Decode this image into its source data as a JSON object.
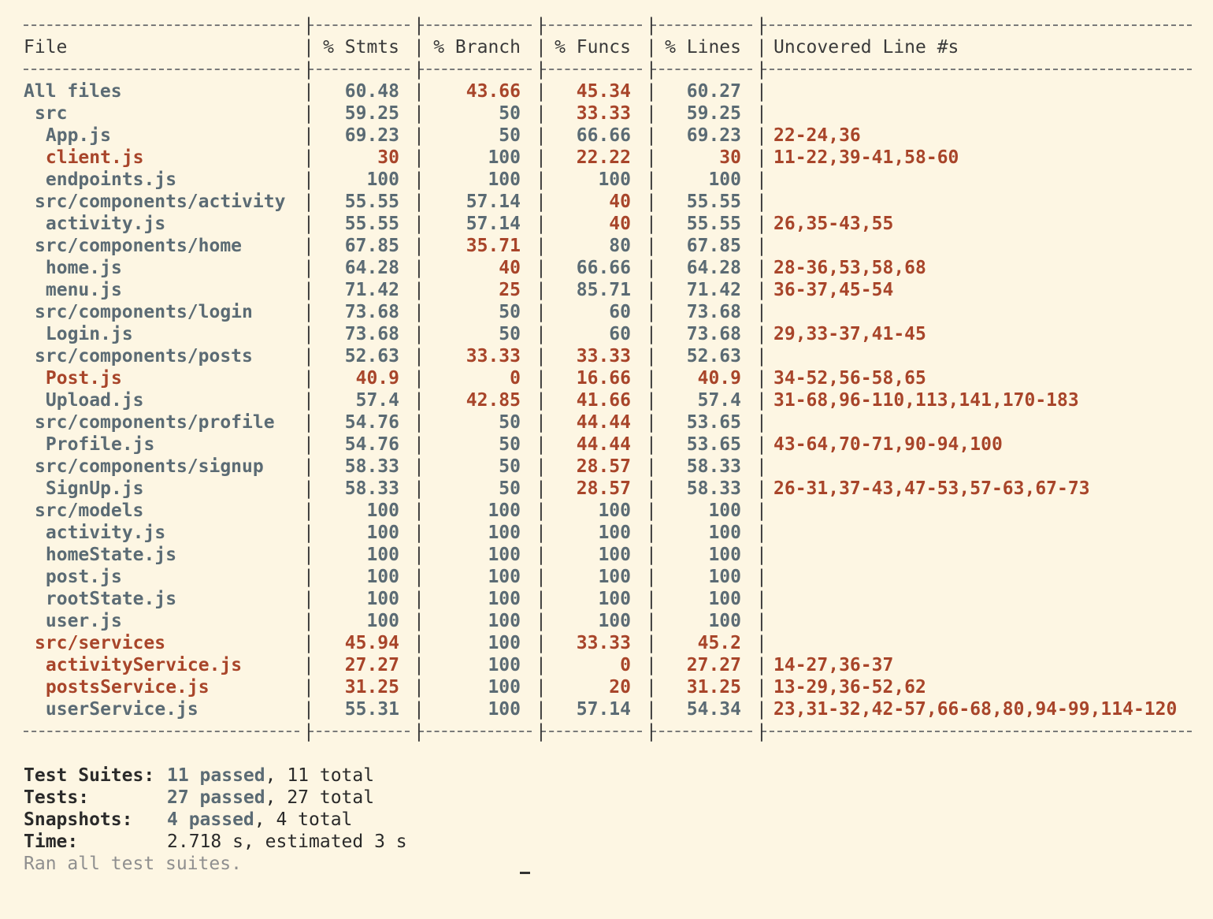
{
  "colors": {
    "good": "#5b6b74",
    "bad": "#a8452a",
    "background": "#fdf6e3",
    "text": "#3a3a3a",
    "muted": "#8f8f8f"
  },
  "headers": [
    "File",
    "% Stmts",
    "% Branch",
    "% Funcs",
    "% Lines",
    "Uncovered Line #s"
  ],
  "rows": [
    {
      "file": "All files",
      "indent": 0,
      "low": false,
      "stmts": "60.48",
      "stmts_low": false,
      "branch": "43.66",
      "branch_low": true,
      "funcs": "45.34",
      "funcs_low": true,
      "lines": "60.27",
      "lines_low": false,
      "uncovered": ""
    },
    {
      "file": "src",
      "indent": 1,
      "low": false,
      "stmts": "59.25",
      "stmts_low": false,
      "branch": "50",
      "branch_low": false,
      "funcs": "33.33",
      "funcs_low": true,
      "lines": "59.25",
      "lines_low": false,
      "uncovered": ""
    },
    {
      "file": "App.js",
      "indent": 2,
      "low": false,
      "stmts": "69.23",
      "stmts_low": false,
      "branch": "50",
      "branch_low": false,
      "funcs": "66.66",
      "funcs_low": false,
      "lines": "69.23",
      "lines_low": false,
      "uncovered": "22-24,36"
    },
    {
      "file": "client.js",
      "indent": 2,
      "low": true,
      "stmts": "30",
      "stmts_low": true,
      "branch": "100",
      "branch_low": false,
      "funcs": "22.22",
      "funcs_low": true,
      "lines": "30",
      "lines_low": true,
      "uncovered": "11-22,39-41,58-60"
    },
    {
      "file": "endpoints.js",
      "indent": 2,
      "low": false,
      "stmts": "100",
      "stmts_low": false,
      "branch": "100",
      "branch_low": false,
      "funcs": "100",
      "funcs_low": false,
      "lines": "100",
      "lines_low": false,
      "uncovered": ""
    },
    {
      "file": "src/components/activity",
      "indent": 1,
      "low": false,
      "stmts": "55.55",
      "stmts_low": false,
      "branch": "57.14",
      "branch_low": false,
      "funcs": "40",
      "funcs_low": true,
      "lines": "55.55",
      "lines_low": false,
      "uncovered": ""
    },
    {
      "file": "activity.js",
      "indent": 2,
      "low": false,
      "stmts": "55.55",
      "stmts_low": false,
      "branch": "57.14",
      "branch_low": false,
      "funcs": "40",
      "funcs_low": true,
      "lines": "55.55",
      "lines_low": false,
      "uncovered": "26,35-43,55"
    },
    {
      "file": "src/components/home",
      "indent": 1,
      "low": false,
      "stmts": "67.85",
      "stmts_low": false,
      "branch": "35.71",
      "branch_low": true,
      "funcs": "80",
      "funcs_low": false,
      "lines": "67.85",
      "lines_low": false,
      "uncovered": ""
    },
    {
      "file": "home.js",
      "indent": 2,
      "low": false,
      "stmts": "64.28",
      "stmts_low": false,
      "branch": "40",
      "branch_low": true,
      "funcs": "66.66",
      "funcs_low": false,
      "lines": "64.28",
      "lines_low": false,
      "uncovered": "28-36,53,58,68"
    },
    {
      "file": "menu.js",
      "indent": 2,
      "low": false,
      "stmts": "71.42",
      "stmts_low": false,
      "branch": "25",
      "branch_low": true,
      "funcs": "85.71",
      "funcs_low": false,
      "lines": "71.42",
      "lines_low": false,
      "uncovered": "36-37,45-54"
    },
    {
      "file": "src/components/login",
      "indent": 1,
      "low": false,
      "stmts": "73.68",
      "stmts_low": false,
      "branch": "50",
      "branch_low": false,
      "funcs": "60",
      "funcs_low": false,
      "lines": "73.68",
      "lines_low": false,
      "uncovered": ""
    },
    {
      "file": "Login.js",
      "indent": 2,
      "low": false,
      "stmts": "73.68",
      "stmts_low": false,
      "branch": "50",
      "branch_low": false,
      "funcs": "60",
      "funcs_low": false,
      "lines": "73.68",
      "lines_low": false,
      "uncovered": "29,33-37,41-45"
    },
    {
      "file": "src/components/posts",
      "indent": 1,
      "low": false,
      "stmts": "52.63",
      "stmts_low": false,
      "branch": "33.33",
      "branch_low": true,
      "funcs": "33.33",
      "funcs_low": true,
      "lines": "52.63",
      "lines_low": false,
      "uncovered": ""
    },
    {
      "file": "Post.js",
      "indent": 2,
      "low": true,
      "stmts": "40.9",
      "stmts_low": true,
      "branch": "0",
      "branch_low": true,
      "funcs": "16.66",
      "funcs_low": true,
      "lines": "40.9",
      "lines_low": true,
      "uncovered": "34-52,56-58,65"
    },
    {
      "file": "Upload.js",
      "indent": 2,
      "low": false,
      "stmts": "57.4",
      "stmts_low": false,
      "branch": "42.85",
      "branch_low": true,
      "funcs": "41.66",
      "funcs_low": true,
      "lines": "57.4",
      "lines_low": false,
      "uncovered": "31-68,96-110,113,141,170-183"
    },
    {
      "file": "src/components/profile",
      "indent": 1,
      "low": false,
      "stmts": "54.76",
      "stmts_low": false,
      "branch": "50",
      "branch_low": false,
      "funcs": "44.44",
      "funcs_low": true,
      "lines": "53.65",
      "lines_low": false,
      "uncovered": ""
    },
    {
      "file": "Profile.js",
      "indent": 2,
      "low": false,
      "stmts": "54.76",
      "stmts_low": false,
      "branch": "50",
      "branch_low": false,
      "funcs": "44.44",
      "funcs_low": true,
      "lines": "53.65",
      "lines_low": false,
      "uncovered": "43-64,70-71,90-94,100"
    },
    {
      "file": "src/components/signup",
      "indent": 1,
      "low": false,
      "stmts": "58.33",
      "stmts_low": false,
      "branch": "50",
      "branch_low": false,
      "funcs": "28.57",
      "funcs_low": true,
      "lines": "58.33",
      "lines_low": false,
      "uncovered": ""
    },
    {
      "file": "SignUp.js",
      "indent": 2,
      "low": false,
      "stmts": "58.33",
      "stmts_low": false,
      "branch": "50",
      "branch_low": false,
      "funcs": "28.57",
      "funcs_low": true,
      "lines": "58.33",
      "lines_low": false,
      "uncovered": "26-31,37-43,47-53,57-63,67-73"
    },
    {
      "file": "src/models",
      "indent": 1,
      "low": false,
      "stmts": "100",
      "stmts_low": false,
      "branch": "100",
      "branch_low": false,
      "funcs": "100",
      "funcs_low": false,
      "lines": "100",
      "lines_low": false,
      "uncovered": ""
    },
    {
      "file": "activity.js",
      "indent": 2,
      "low": false,
      "stmts": "100",
      "stmts_low": false,
      "branch": "100",
      "branch_low": false,
      "funcs": "100",
      "funcs_low": false,
      "lines": "100",
      "lines_low": false,
      "uncovered": ""
    },
    {
      "file": "homeState.js",
      "indent": 2,
      "low": false,
      "stmts": "100",
      "stmts_low": false,
      "branch": "100",
      "branch_low": false,
      "funcs": "100",
      "funcs_low": false,
      "lines": "100",
      "lines_low": false,
      "uncovered": ""
    },
    {
      "file": "post.js",
      "indent": 2,
      "low": false,
      "stmts": "100",
      "stmts_low": false,
      "branch": "100",
      "branch_low": false,
      "funcs": "100",
      "funcs_low": false,
      "lines": "100",
      "lines_low": false,
      "uncovered": ""
    },
    {
      "file": "rootState.js",
      "indent": 2,
      "low": false,
      "stmts": "100",
      "stmts_low": false,
      "branch": "100",
      "branch_low": false,
      "funcs": "100",
      "funcs_low": false,
      "lines": "100",
      "lines_low": false,
      "uncovered": ""
    },
    {
      "file": "user.js",
      "indent": 2,
      "low": false,
      "stmts": "100",
      "stmts_low": false,
      "branch": "100",
      "branch_low": false,
      "funcs": "100",
      "funcs_low": false,
      "lines": "100",
      "lines_low": false,
      "uncovered": ""
    },
    {
      "file": "src/services",
      "indent": 1,
      "low": true,
      "stmts": "45.94",
      "stmts_low": true,
      "branch": "100",
      "branch_low": false,
      "funcs": "33.33",
      "funcs_low": true,
      "lines": "45.2",
      "lines_low": true,
      "uncovered": ""
    },
    {
      "file": "activityService.js",
      "indent": 2,
      "low": true,
      "stmts": "27.27",
      "stmts_low": true,
      "branch": "100",
      "branch_low": false,
      "funcs": "0",
      "funcs_low": true,
      "lines": "27.27",
      "lines_low": true,
      "uncovered": "14-27,36-37"
    },
    {
      "file": "postsService.js",
      "indent": 2,
      "low": true,
      "stmts": "31.25",
      "stmts_low": true,
      "branch": "100",
      "branch_low": false,
      "funcs": "20",
      "funcs_low": true,
      "lines": "31.25",
      "lines_low": true,
      "uncovered": "13-29,36-52,62"
    },
    {
      "file": "userService.js",
      "indent": 2,
      "low": false,
      "stmts": "55.31",
      "stmts_low": false,
      "branch": "100",
      "branch_low": false,
      "funcs": "57.14",
      "funcs_low": false,
      "lines": "54.34",
      "lines_low": false,
      "uncovered": "23,31-32,42-57,66-68,80,94-99,114-120"
    }
  ],
  "summary": [
    {
      "label": "Test Suites:",
      "passed": "11 passed",
      "rest": ", 11 total"
    },
    {
      "label": "Tests:",
      "passed": "27 passed",
      "rest": ", 27 total"
    },
    {
      "label": "Snapshots:",
      "passed": "4 passed",
      "rest": ", 4 total"
    },
    {
      "label": "Time:",
      "passed": "",
      "rest": "2.718 s, estimated 3 s"
    }
  ],
  "footer": "Ran all test suites."
}
